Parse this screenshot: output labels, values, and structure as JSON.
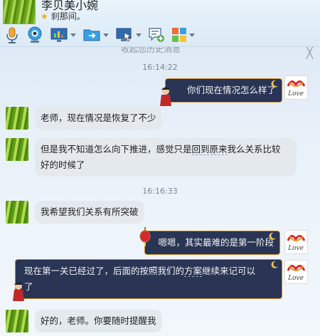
{
  "header": {
    "contact_name": "李贝美小婉",
    "status": "刹那间。"
  },
  "toolbar": {
    "buttons": [
      {
        "icon": "microphone-icon"
      },
      {
        "icon": "webcam-icon"
      },
      {
        "icon": "screen-share-icon"
      },
      {
        "icon": "file-transfer-icon"
      },
      {
        "icon": "remote-desktop-icon"
      },
      {
        "icon": "chat-add-icon"
      },
      {
        "icon": "apps-grid-icon"
      }
    ]
  },
  "chat": {
    "history_link": "收起您历史消息",
    "close_glyph": "╳",
    "timestamps": [
      "16:14:22",
      "16:16:33"
    ],
    "messages": [
      {
        "from": "me",
        "text": "你们现在情况怎么样了"
      },
      {
        "from": "them",
        "text": "老师，现在情况是恢复了不少"
      },
      {
        "from": "them",
        "text_line1a": "但是我不知道怎么向下推进，感觉只是",
        "text_line1u": "回到原来",
        "text_line1b": "我么关系比较",
        "text_line2": "好的时候了"
      },
      {
        "from": "them",
        "text": "我希望我们关系有所突破"
      },
      {
        "from": "me",
        "text": "嗯嗯，其实最难的是第一阶段"
      },
      {
        "from": "me",
        "text_line1a": "现在第一关已经过了，后面的按照我们的",
        "text_line1u": "方案",
        "text_line1b": "继续来记可以",
        "text_line2": "了"
      },
      {
        "from": "them",
        "text": "好的，老师。你要随时提醒我"
      }
    ],
    "me_avatar_text": "Love",
    "colors": {
      "out_bubble": "#2a3555",
      "out_border": "#cc8a2a",
      "in_bubble": "#e4e9ee"
    }
  }
}
